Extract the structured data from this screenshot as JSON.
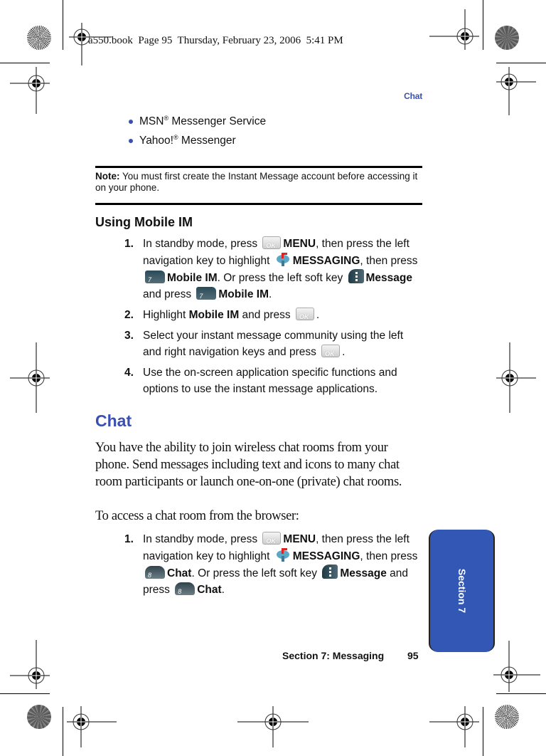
{
  "print_slug": "a550.book  Page 95  Thursday, February 23, 2006  5:41 PM",
  "running_head": "Chat",
  "bullets": [
    {
      "text": "MSN",
      "sup": "®",
      "rest": " Messenger Service"
    },
    {
      "text": "Yahoo!",
      "sup": "®",
      "rest": " Messenger"
    }
  ],
  "note": {
    "label": "Note:",
    "text": " You must first create the Instant Message account before accessing it on your phone."
  },
  "using_mobile_im": {
    "heading": "Using Mobile IM",
    "steps": [
      {
        "num": "1.",
        "parts": [
          {
            "t": "In standby mode, press "
          },
          {
            "icon": "ok-key"
          },
          {
            "b": "MENU"
          },
          {
            "t": ", then press the left navigation key to highlight "
          },
          {
            "icon": "messaging-icon"
          },
          {
            "b": "MESSAGING"
          },
          {
            "t": ", then press "
          },
          {
            "icon": "key-7"
          },
          {
            "b": "Mobile IM"
          },
          {
            "t": ".  Or press the left soft key "
          },
          {
            "icon": "soft-key"
          },
          {
            "b": "Message"
          },
          {
            "t": " and press "
          },
          {
            "icon": "key-7"
          },
          {
            "b": "Mobile IM"
          },
          {
            "t": "."
          }
        ]
      },
      {
        "num": "2.",
        "parts": [
          {
            "t": "Highlight "
          },
          {
            "b": "Mobile IM"
          },
          {
            "t": " and press "
          },
          {
            "icon": "ok-key"
          },
          {
            "t": "."
          }
        ]
      },
      {
        "num": "3.",
        "parts": [
          {
            "t": "Select your instant message community using the left and right navigation keys and press "
          },
          {
            "icon": "ok-key"
          },
          {
            "t": "."
          }
        ]
      },
      {
        "num": "4.",
        "parts": [
          {
            "t": "Use the on-screen application specific functions and options to use the instant message applications."
          }
        ]
      }
    ]
  },
  "chat": {
    "heading": "Chat",
    "paragraph": "You have the ability to join wireless chat rooms from your phone. Send messages including text and icons to many chat room participants or launch one-on-one (private) chat rooms.",
    "intro": "To access a chat room from the browser:",
    "steps": [
      {
        "num": "1.",
        "parts": [
          {
            "t": "In standby mode, press "
          },
          {
            "icon": "ok-key"
          },
          {
            "b": "MENU"
          },
          {
            "t": ", then press the left navigation key to highlight "
          },
          {
            "icon": "messaging-icon"
          },
          {
            "b": "MESSAGING"
          },
          {
            "t": ", then press "
          },
          {
            "icon": "key-8"
          },
          {
            "b": "Chat"
          },
          {
            "t": ".  Or press the left soft key "
          },
          {
            "icon": "soft-key"
          },
          {
            "b": "Message"
          },
          {
            "t": " and press "
          },
          {
            "icon": "key-8"
          },
          {
            "b": "Chat"
          },
          {
            "t": "."
          }
        ]
      }
    ]
  },
  "section_tab": {
    "label": "Section 7",
    "color": "#3257b5"
  },
  "footer": {
    "section": "Section 7: Messaging",
    "page": "95"
  },
  "colors": {
    "accent": "#3a4fb0"
  }
}
